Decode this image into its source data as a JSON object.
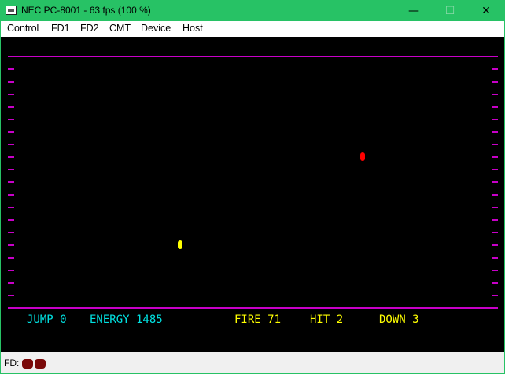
{
  "window": {
    "title": "NEC PC-8001 - 63 fps (100 %)",
    "minimize_glyph": "—",
    "maximize_glyph": "☐",
    "close_glyph": "✕"
  },
  "menu": [
    "Control",
    "FD1",
    "FD2",
    "CMT",
    "Device",
    "Host"
  ],
  "game": {
    "border_color": "#c800c8",
    "jump": "JUMP 0",
    "energy": "ENERGY 1485",
    "fire": "FIRE 71",
    "hit": "HIT 2",
    "down": "DOWN 3",
    "player_color": "#ffff00",
    "enemy_color": "#ff0000"
  },
  "status": {
    "fd_label": "FD:",
    "led_color": "#7a0a0a"
  }
}
